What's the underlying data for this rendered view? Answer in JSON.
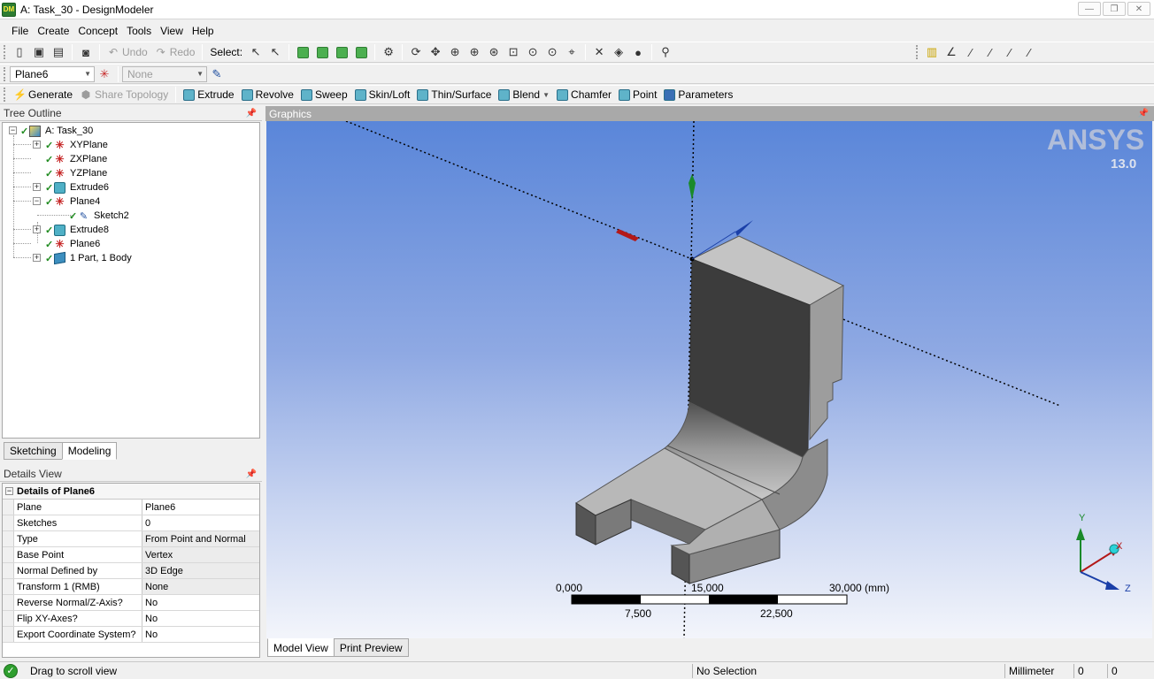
{
  "window": {
    "title": "A: Task_30 - DesignModeler",
    "badge": "DM",
    "buttons": [
      "—",
      "❐",
      "✕"
    ]
  },
  "menu": [
    "File",
    "Create",
    "Concept",
    "Tools",
    "View",
    "Help"
  ],
  "toolbar1": {
    "undo": "Undo",
    "redo": "Redo",
    "select_label": "Select:"
  },
  "toolbar2": {
    "plane_value": "Plane6",
    "sketch_value": "None"
  },
  "toolbar3": {
    "generate": "Generate",
    "share_topology": "Share Topology",
    "extrude": "Extrude",
    "revolve": "Revolve",
    "sweep": "Sweep",
    "skin_loft": "Skin/Loft",
    "thin_surface": "Thin/Surface",
    "blend": "Blend",
    "chamfer": "Chamfer",
    "point": "Point",
    "parameters": "Parameters"
  },
  "tree": {
    "header": "Tree Outline",
    "root": "A: Task_30",
    "items": [
      {
        "label": "XYPlane",
        "icon": "plane-icon"
      },
      {
        "label": "ZXPlane",
        "icon": "plane-icon"
      },
      {
        "label": "YZPlane",
        "icon": "plane-icon"
      },
      {
        "label": "Extrude6",
        "icon": "extrude-icon"
      },
      {
        "label": "Plane4",
        "icon": "plane-icon"
      },
      {
        "label": "Sketch2",
        "icon": "sketch-icon"
      },
      {
        "label": "Extrude8",
        "icon": "extrude-icon"
      },
      {
        "label": "Plane6",
        "icon": "plane-icon"
      },
      {
        "label": "1 Part, 1 Body",
        "icon": "body-icon"
      }
    ],
    "tabs": [
      "Sketching",
      "Modeling"
    ],
    "active_tab": "Modeling"
  },
  "details": {
    "header": "Details View",
    "title": "Details of Plane6",
    "rows": [
      {
        "key": "Plane",
        "value": "Plane6"
      },
      {
        "key": "Sketches",
        "value": "0"
      },
      {
        "key": "Type",
        "value": "From Point and Normal"
      },
      {
        "key": "Base Point",
        "value": "Vertex"
      },
      {
        "key": "Normal Defined by",
        "value": "3D Edge"
      },
      {
        "key": "Transform 1 (RMB)",
        "value": "None"
      },
      {
        "key": "Reverse Normal/Z-Axis?",
        "value": "No"
      },
      {
        "key": "Flip XY-Axes?",
        "value": "No"
      },
      {
        "key": "Export Coordinate System?",
        "value": "No"
      }
    ]
  },
  "graphics": {
    "header": "Graphics",
    "logo": "ANSYS",
    "version": "13.0",
    "scale_top": [
      "0,000",
      "15,000",
      "30,000 (mm)"
    ],
    "scale_bottom": [
      "7,500",
      "22,500"
    ],
    "triad": {
      "x": "X",
      "y": "Y",
      "z": "Z"
    },
    "view_tabs": [
      "Model View",
      "Print Preview"
    ],
    "active_view_tab": "Model View"
  },
  "status": {
    "message": "Drag to scroll view",
    "selection": "No Selection",
    "units": "Millimeter",
    "coord1": "0",
    "coord2": "0"
  },
  "colors": {
    "viewport_top": "#5a86d9",
    "viewport_bottom": "#f3f5fb",
    "status_ok": "#2e9e2e"
  }
}
